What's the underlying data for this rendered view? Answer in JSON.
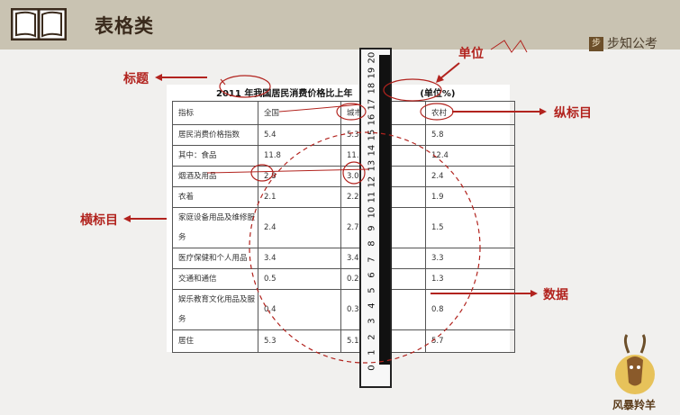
{
  "header": {
    "title": "表格类",
    "brand": "步知公考",
    "brand_icon": "步"
  },
  "caption": "2011 年我国居民消费价格比上年",
  "unit_fragment": "(单位%)",
  "table": {
    "rows": [
      [
        "指标",
        "全国",
        "城市",
        "农村"
      ],
      [
        "居民消费价格指数",
        "5.4",
        "5.3",
        "5.8"
      ],
      [
        "其中：食品",
        "11.8",
        "11.6",
        "12.4"
      ],
      [
        "烟酒及用品",
        "2.8",
        "3.0",
        "2.4"
      ],
      [
        "衣着",
        "2.1",
        "2.2",
        "1.9"
      ],
      [
        "家庭设备用品及维修服务",
        "2.4",
        "2.7",
        "1.5"
      ],
      [
        "医疗保健和个人用品",
        "3.4",
        "3.4",
        "3.3"
      ],
      [
        "交通和通信",
        "0.5",
        "0.2",
        "1.3"
      ],
      [
        "娱乐教育文化用品及服务",
        "0.4",
        "0.3",
        "0.8"
      ],
      [
        "居住",
        "5.3",
        "5.1",
        "5.7"
      ]
    ]
  },
  "labels": {
    "biaoti": "标题",
    "danwei": "单位",
    "zongbiaomu": "纵标目",
    "hengbiaomu": "横标目",
    "shuju": "数据"
  },
  "ruler": {
    "numbers": [
      "20",
      "19",
      "18",
      "17",
      "16",
      "15",
      "14",
      "13",
      "12",
      "11",
      "10",
      "9",
      "8",
      "7",
      "6",
      "5",
      "4",
      "3",
      "2",
      "1",
      "0"
    ]
  },
  "logo": {
    "text": "风暴羚羊"
  },
  "colors": {
    "annotation": "#b2231e",
    "header_bg": "#c9c3b2"
  }
}
